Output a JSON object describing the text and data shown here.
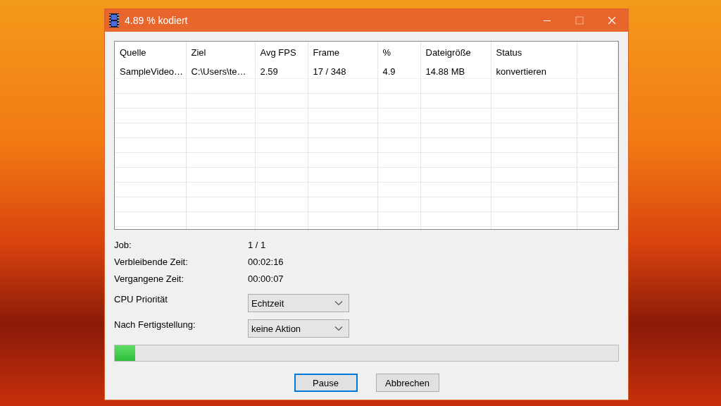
{
  "window": {
    "title": "4.89 % kodiert"
  },
  "table": {
    "columns": [
      "Quelle",
      "Ziel",
      "Avg FPS",
      "Frame",
      "%",
      "Dateigröße",
      "Status"
    ],
    "rows": [
      [
        "SampleVideo…",
        "C:\\Users\\te…",
        "2.59",
        "17 / 348",
        "4.9",
        "14.88 MB",
        "konvertieren"
      ]
    ]
  },
  "info": [
    {
      "label": "Job:",
      "value": "1 / 1"
    },
    {
      "label": "Verbleibende Zeit:",
      "value": "00:02:16"
    },
    {
      "label": "Vergangene Zeit:",
      "value": "00:00:07"
    }
  ],
  "options": [
    {
      "label": "CPU Priorität",
      "value": "Echtzeit"
    },
    {
      "label": "Nach Fertigstellung:",
      "value": "keine Aktion"
    }
  ],
  "progress": {
    "level": 0.04
  },
  "buttons": [
    {
      "label": "Pause",
      "focused": true
    },
    {
      "label": "Abbrechen",
      "focused": false
    }
  ]
}
